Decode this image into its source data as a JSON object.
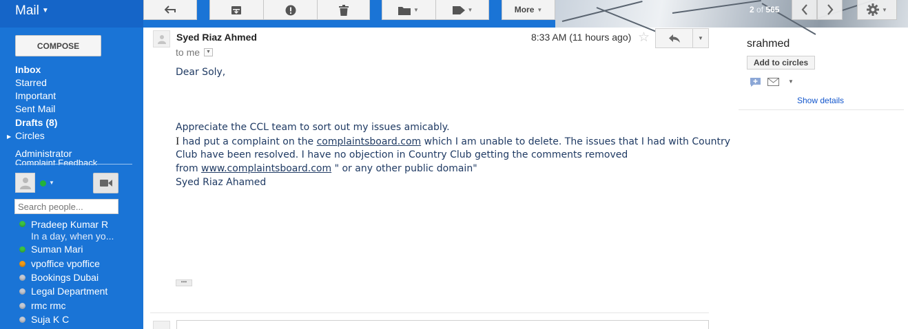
{
  "colors": {
    "sidebar_bg": "#1a74d6",
    "link": "#1155cc",
    "body_text": "#1f3a63"
  },
  "app": {
    "label": "Mail"
  },
  "sidebar": {
    "compose_label": "COMPOSE",
    "nav": [
      {
        "label": "Inbox",
        "bold": true
      },
      {
        "label": "Starred"
      },
      {
        "label": "Important"
      },
      {
        "label": "Sent Mail"
      },
      {
        "label": "Drafts (8)",
        "bold": true
      },
      {
        "label": "Circles",
        "icon": "expand-triangle-icon"
      },
      {
        "label": "Administrator"
      }
    ],
    "nav_clipped_label": "Complaint Feedback",
    "chat": {
      "search_placeholder": "Search people...",
      "contacts": [
        {
          "name": "Pradeep Kumar R",
          "status": "online",
          "message": "In a day, when yo..."
        },
        {
          "name": "Suman Mari",
          "status": "online"
        },
        {
          "name": "vpoffice vpoffice",
          "status": "away"
        },
        {
          "name": "Bookings Dubai",
          "status": "offline"
        },
        {
          "name": "Legal Department",
          "status": "offline"
        },
        {
          "name": "rmc rmc",
          "status": "offline"
        },
        {
          "name": "Suja K C",
          "status": "offline"
        }
      ]
    }
  },
  "toolbar": {
    "more_label": "More",
    "pager": {
      "current": "2",
      "of_label": "of",
      "total": "565"
    },
    "icons": [
      "back-arrow-icon",
      "archive-icon",
      "report-spam-icon",
      "delete-icon",
      "folder-icon",
      "label-icon",
      "chevron-left-icon",
      "chevron-right-icon",
      "gear-icon"
    ]
  },
  "message": {
    "sender": "Syed Riaz Ahmed",
    "recipient_label": "to me",
    "time": "8:33 AM (11 hours ago)",
    "greeting": "Dear Soly,",
    "line1": "Appreciate the CCL team to sort out my issues amicably.",
    "line2_prefix": "I",
    "line2_a": " had put a complaint on the ",
    "link1": "complaintsboard.com",
    "line2_b": " which I am unable to delete. The issues that I had with Country",
    "line3": "Club have been resolved. I have no objection in Country Club getting the comments removed",
    "line4_a": "from ",
    "link2": "www.complaintsboard.com",
    "line4_b": " \" or any other public domain\"",
    "signature": "Syed Riaz Ahamed"
  },
  "right_panel": {
    "name": "srahmed",
    "add_circles_label": "Add to circles",
    "show_details_label": "Show details"
  }
}
